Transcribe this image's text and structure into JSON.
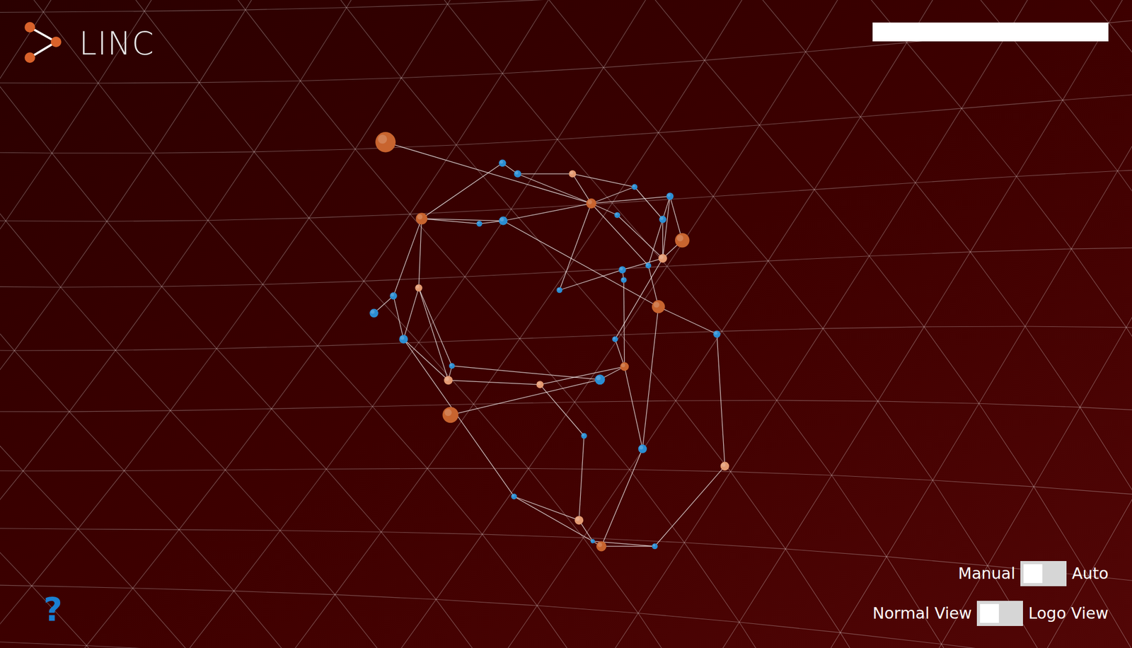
{
  "app": {
    "title": "LINC"
  },
  "search": {
    "value": ""
  },
  "help": {
    "label": "?"
  },
  "toggles": [
    {
      "left": "Manual",
      "right": "Auto",
      "on": false
    },
    {
      "left": "Normal View",
      "right": "Logo View",
      "on": false
    }
  ],
  "graph": {
    "nodes": [
      {
        "color": "#c8642f"
      },
      {
        "color": "#2b8ed3"
      },
      {
        "color": "#2b8ed3"
      },
      {
        "color": "#e39a72"
      },
      {
        "color": "#c8642f"
      },
      {
        "color": "#2b8ed3"
      },
      {
        "color": "#2b8ed3"
      },
      {
        "color": "#c8642f"
      },
      {
        "color": "#2b8ed3"
      },
      {
        "color": "#2b8ed3"
      },
      {
        "color": "#2b8ed3"
      },
      {
        "color": "#2b8ed3"
      },
      {
        "color": "#c8642f"
      },
      {
        "color": "#e39a72"
      },
      {
        "color": "#2b8ed3"
      },
      {
        "color": "#2b8ed3"
      },
      {
        "color": "#2b8ed3"
      },
      {
        "color": "#e39a72"
      },
      {
        "color": "#2b8ed3"
      },
      {
        "color": "#2b8ed3"
      },
      {
        "color": "#2b8ed3"
      },
      {
        "color": "#c8642f"
      },
      {
        "color": "#2b8ed3"
      },
      {
        "color": "#2b8ed3"
      },
      {
        "color": "#2b8ed3"
      },
      {
        "color": "#2b8ed3"
      },
      {
        "color": "#e39a72"
      },
      {
        "color": "#e39a72"
      },
      {
        "color": "#2b8ed3"
      },
      {
        "color": "#c8642f"
      },
      {
        "color": "#c8642f"
      },
      {
        "color": "#2b8ed3"
      },
      {
        "color": "#2b8ed3"
      },
      {
        "color": "#e39a72"
      },
      {
        "color": "#2b8ed3"
      },
      {
        "color": "#e39a72"
      },
      {
        "color": "#2b8ed3"
      },
      {
        "color": "#c8642f"
      },
      {
        "color": "#2b8ed3"
      }
    ],
    "edges": [
      [
        0,
        7
      ],
      [
        1,
        4
      ],
      [
        1,
        2
      ],
      [
        2,
        3
      ],
      [
        2,
        7
      ],
      [
        3,
        7
      ],
      [
        3,
        8
      ],
      [
        4,
        5
      ],
      [
        4,
        6
      ],
      [
        4,
        17
      ],
      [
        4,
        18
      ],
      [
        5,
        6
      ],
      [
        6,
        7
      ],
      [
        7,
        8
      ],
      [
        7,
        9
      ],
      [
        7,
        10
      ],
      [
        7,
        14
      ],
      [
        7,
        20
      ],
      [
        8,
        11
      ],
      [
        9,
        11
      ],
      [
        9,
        13
      ],
      [
        10,
        13
      ],
      [
        11,
        13
      ],
      [
        11,
        14
      ],
      [
        12,
        13
      ],
      [
        12,
        9
      ],
      [
        13,
        15
      ],
      [
        13,
        24
      ],
      [
        14,
        21
      ],
      [
        15,
        16
      ],
      [
        16,
        29
      ],
      [
        20,
        15
      ],
      [
        21,
        22
      ],
      [
        21,
        32
      ],
      [
        22,
        33
      ],
      [
        17,
        23
      ],
      [
        17,
        26
      ],
      [
        18,
        19
      ],
      [
        18,
        23
      ],
      [
        23,
        26
      ],
      [
        23,
        34
      ],
      [
        25,
        26
      ],
      [
        25,
        28
      ],
      [
        26,
        27
      ],
      [
        27,
        29
      ],
      [
        27,
        31
      ],
      [
        28,
        29
      ],
      [
        29,
        24
      ],
      [
        29,
        32
      ],
      [
        30,
        28
      ],
      [
        31,
        35
      ],
      [
        34,
        35
      ],
      [
        34,
        37
      ],
      [
        35,
        36
      ],
      [
        36,
        38
      ],
      [
        37,
        38
      ],
      [
        37,
        32
      ],
      [
        33,
        38
      ],
      [
        6,
        21
      ],
      [
        25,
        17
      ]
    ]
  }
}
